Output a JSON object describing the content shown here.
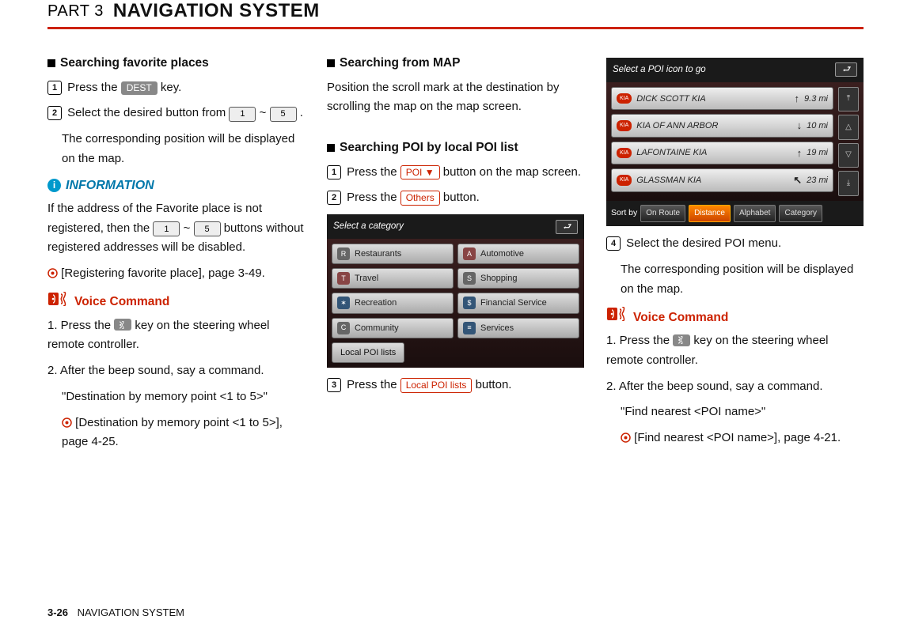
{
  "header": {
    "part": "PART 3",
    "title": "NAVIGATION SYSTEM"
  },
  "footer": {
    "page": "3-26",
    "title": "NAVIGATION SYSTEM"
  },
  "col1": {
    "h1": "Searching favorite places",
    "s1_pre": "Press the ",
    "s1_key": "DEST",
    "s1_post": " key.",
    "s2_pre": "Select the desired button from ",
    "s2_k1": "1",
    "s2_tilde": " ~ ",
    "s2_k2": "5",
    "s2_post": " .",
    "s2_note": "The corresponding position will be displayed on the map.",
    "info_hd": "INFORMATION",
    "info_p1_pre": "If the address of the Favorite place is not registered, then the ",
    "info_k1": "1",
    "info_tilde": " ~ ",
    "info_k2": "5",
    "info_p1_post": " buttons without registered addresses will be disabled.",
    "info_ref": " [Registering favorite place], page 3-49.",
    "voice_hd": "Voice Command",
    "voice_1_pre": "1. Press the ",
    "voice_1_post": "  key on the steering wheel remote controller.",
    "voice_2": "2. After the beep sound, say a command.",
    "voice_q": "\"Destination by memory point <1 to 5>\"",
    "voice_ref": " [Destination by memory point <1 to 5>], page 4-25."
  },
  "col2": {
    "h1": "Searching from MAP",
    "p1": "Position the scroll mark at the destination by scrolling the map on the map screen.",
    "h2": "Searching POI by local POI list",
    "s1_pre": "Press the ",
    "s1_key": "POI ▼",
    "s1_post": " button on the map screen.",
    "s2_pre": "Press the ",
    "s2_key": "Others",
    "s2_post": " button.",
    "ui": {
      "title": "Select a category",
      "cats": [
        {
          "label": "Restaurants",
          "ico": "R",
          "cls": "grey"
        },
        {
          "label": "Automotive",
          "ico": "A",
          "cls": ""
        },
        {
          "label": "Travel",
          "ico": "T",
          "cls": ""
        },
        {
          "label": "Shopping",
          "ico": "S",
          "cls": "grey"
        },
        {
          "label": "Recreation",
          "ico": "✶",
          "cls": "blue"
        },
        {
          "label": "Financial Service",
          "ico": "$",
          "cls": "blue"
        },
        {
          "label": "Community",
          "ico": "C",
          "cls": "grey"
        },
        {
          "label": "Services",
          "ico": "≡",
          "cls": "blue"
        }
      ],
      "local": "Local POI lists"
    },
    "s3_pre": "Press the ",
    "s3_key": "Local POI lists",
    "s3_post": " button."
  },
  "col3": {
    "ui": {
      "title": "Select a POI icon to go",
      "rows": [
        {
          "name": "DICK SCOTT KIA",
          "arrow": "↑",
          "dist": "9.3 mi"
        },
        {
          "name": "KIA OF ANN ARBOR",
          "arrow": "↓",
          "dist": "10 mi"
        },
        {
          "name": "LAFONTAINE KIA",
          "arrow": "↑",
          "dist": "19 mi"
        },
        {
          "name": "GLASSMAN KIA",
          "arrow": "↖",
          "dist": "23 mi"
        }
      ],
      "sort_label": "Sort by",
      "sort_opts": [
        "On Route",
        "Distance",
        "Alphabet",
        "Category"
      ],
      "sort_active": 1
    },
    "s4": "Select the desired POI menu.",
    "s4_note": "The corresponding position will be displayed on the map.",
    "voice_hd": "Voice Command",
    "voice_1_pre": "1. Press the ",
    "voice_1_post": "  key on the steering wheel remote controller.",
    "voice_2": "2. After the beep sound, say a command.",
    "voice_q": "\"Find nearest <POI name>\"",
    "voice_ref": " [Find nearest <POI name>], page 4-21."
  }
}
